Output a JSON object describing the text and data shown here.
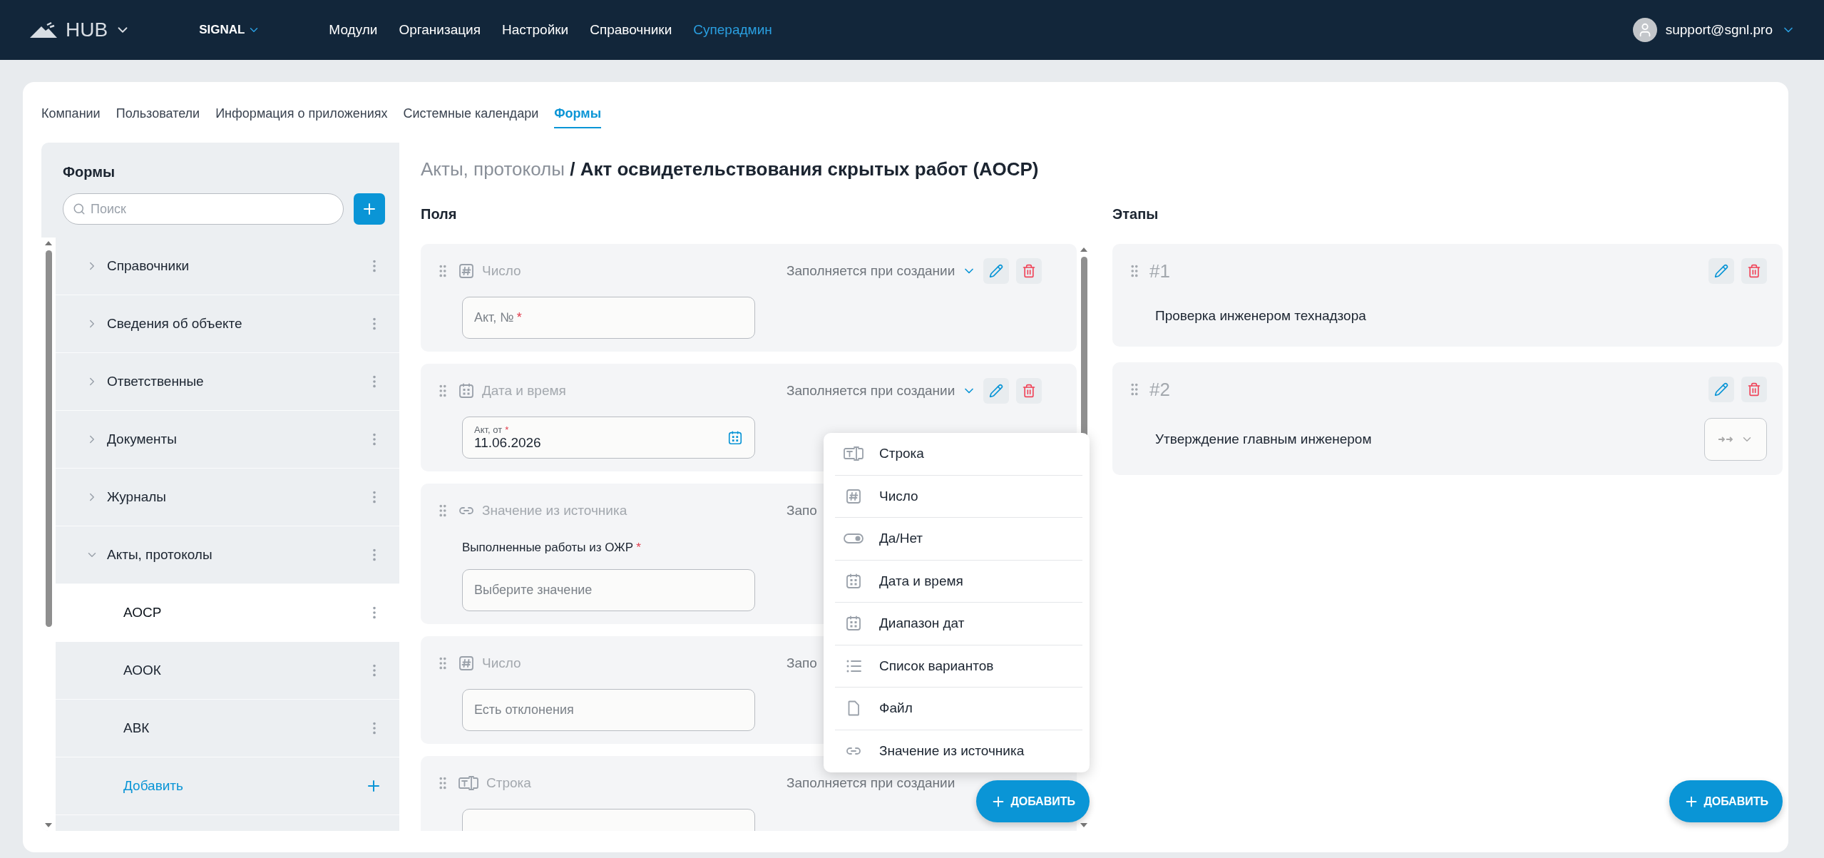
{
  "topbar": {
    "brand": "HUB",
    "workspace": "SIGNAL",
    "nav": [
      {
        "label": "Модули",
        "selected": false
      },
      {
        "label": "Организация",
        "selected": false
      },
      {
        "label": "Настройки",
        "selected": false
      },
      {
        "label": "Справочники",
        "selected": false
      },
      {
        "label": "Суперадмин",
        "selected": true
      }
    ],
    "user": "support@sgnl.pro"
  },
  "tabs": [
    {
      "label": "Компании",
      "selected": false
    },
    {
      "label": "Пользователи",
      "selected": false
    },
    {
      "label": "Информация о приложениях",
      "selected": false
    },
    {
      "label": "Системные календари",
      "selected": false
    },
    {
      "label": "Формы",
      "selected": true
    }
  ],
  "sidebar": {
    "title": "Формы",
    "search": {
      "placeholder": "Поиск"
    },
    "items": [
      {
        "label": "Справочники",
        "expanded": false
      },
      {
        "label": "Сведения об объекте",
        "expanded": false
      },
      {
        "label": "Ответственные",
        "expanded": false
      },
      {
        "label": "Документы",
        "expanded": false
      },
      {
        "label": "Журналы",
        "expanded": false
      },
      {
        "label": "Акты, протоколы",
        "expanded": true,
        "children": [
          {
            "label": "АОСР",
            "selected": true
          },
          {
            "label": "АООК",
            "selected": false
          },
          {
            "label": "АВК",
            "selected": false
          }
        ],
        "add_label": "Добавить"
      }
    ]
  },
  "breadcrumb": {
    "parent": "Акты, протоколы",
    "separator": "/",
    "current": "Акт освидетельствования скрытых работ (АОСР)"
  },
  "fields": {
    "title": "Поля",
    "items": [
      {
        "kind": "number",
        "type_label": "Число",
        "mode": "Заполняется при создании",
        "actions": true,
        "input": {
          "kind": "text",
          "placeholder": "Акт, №",
          "required_mark": "*"
        }
      },
      {
        "kind": "datetime",
        "type_label": "Дата и время",
        "mode": "Заполняется при создании",
        "actions": true,
        "input": {
          "kind": "date",
          "label": "Акт, от",
          "required_mark": "*",
          "value": "11.06.2026"
        }
      },
      {
        "kind": "source",
        "type_label": "Значение из источника",
        "mode": "Запо",
        "actions": false,
        "input": {
          "kind": "select",
          "label": "Выполненные работы из ОЖР",
          "required_mark": "*",
          "placeholder": "Выберите значение"
        }
      },
      {
        "kind": "number",
        "type_label": "Число",
        "mode": "Запо",
        "actions": false,
        "input": {
          "kind": "text",
          "placeholder": "Есть отклонения"
        }
      },
      {
        "kind": "string",
        "type_label": "Строка",
        "mode": "Заполняется при создании",
        "actions": false,
        "input": {
          "kind": "text"
        }
      }
    ],
    "add_button": "ДОБАВИТЬ"
  },
  "type_menu": [
    {
      "kind": "string",
      "label": "Строка"
    },
    {
      "kind": "number",
      "label": "Число"
    },
    {
      "kind": "boolean",
      "label": "Да/Нет"
    },
    {
      "kind": "datetime",
      "label": "Дата и время"
    },
    {
      "kind": "daterange",
      "label": "Диапазон дат"
    },
    {
      "kind": "list",
      "label": "Список вариантов"
    },
    {
      "kind": "file",
      "label": "Файл"
    },
    {
      "kind": "source",
      "label": "Значение из источника"
    }
  ],
  "stages": {
    "title": "Этапы",
    "items": [
      {
        "number": "#1",
        "title": "Проверка инженером технадзора",
        "transition_select": false
      },
      {
        "number": "#2",
        "title": "Утверждение главным инженером",
        "transition_select": true
      }
    ],
    "add_button": "ДОБАВИТЬ"
  }
}
